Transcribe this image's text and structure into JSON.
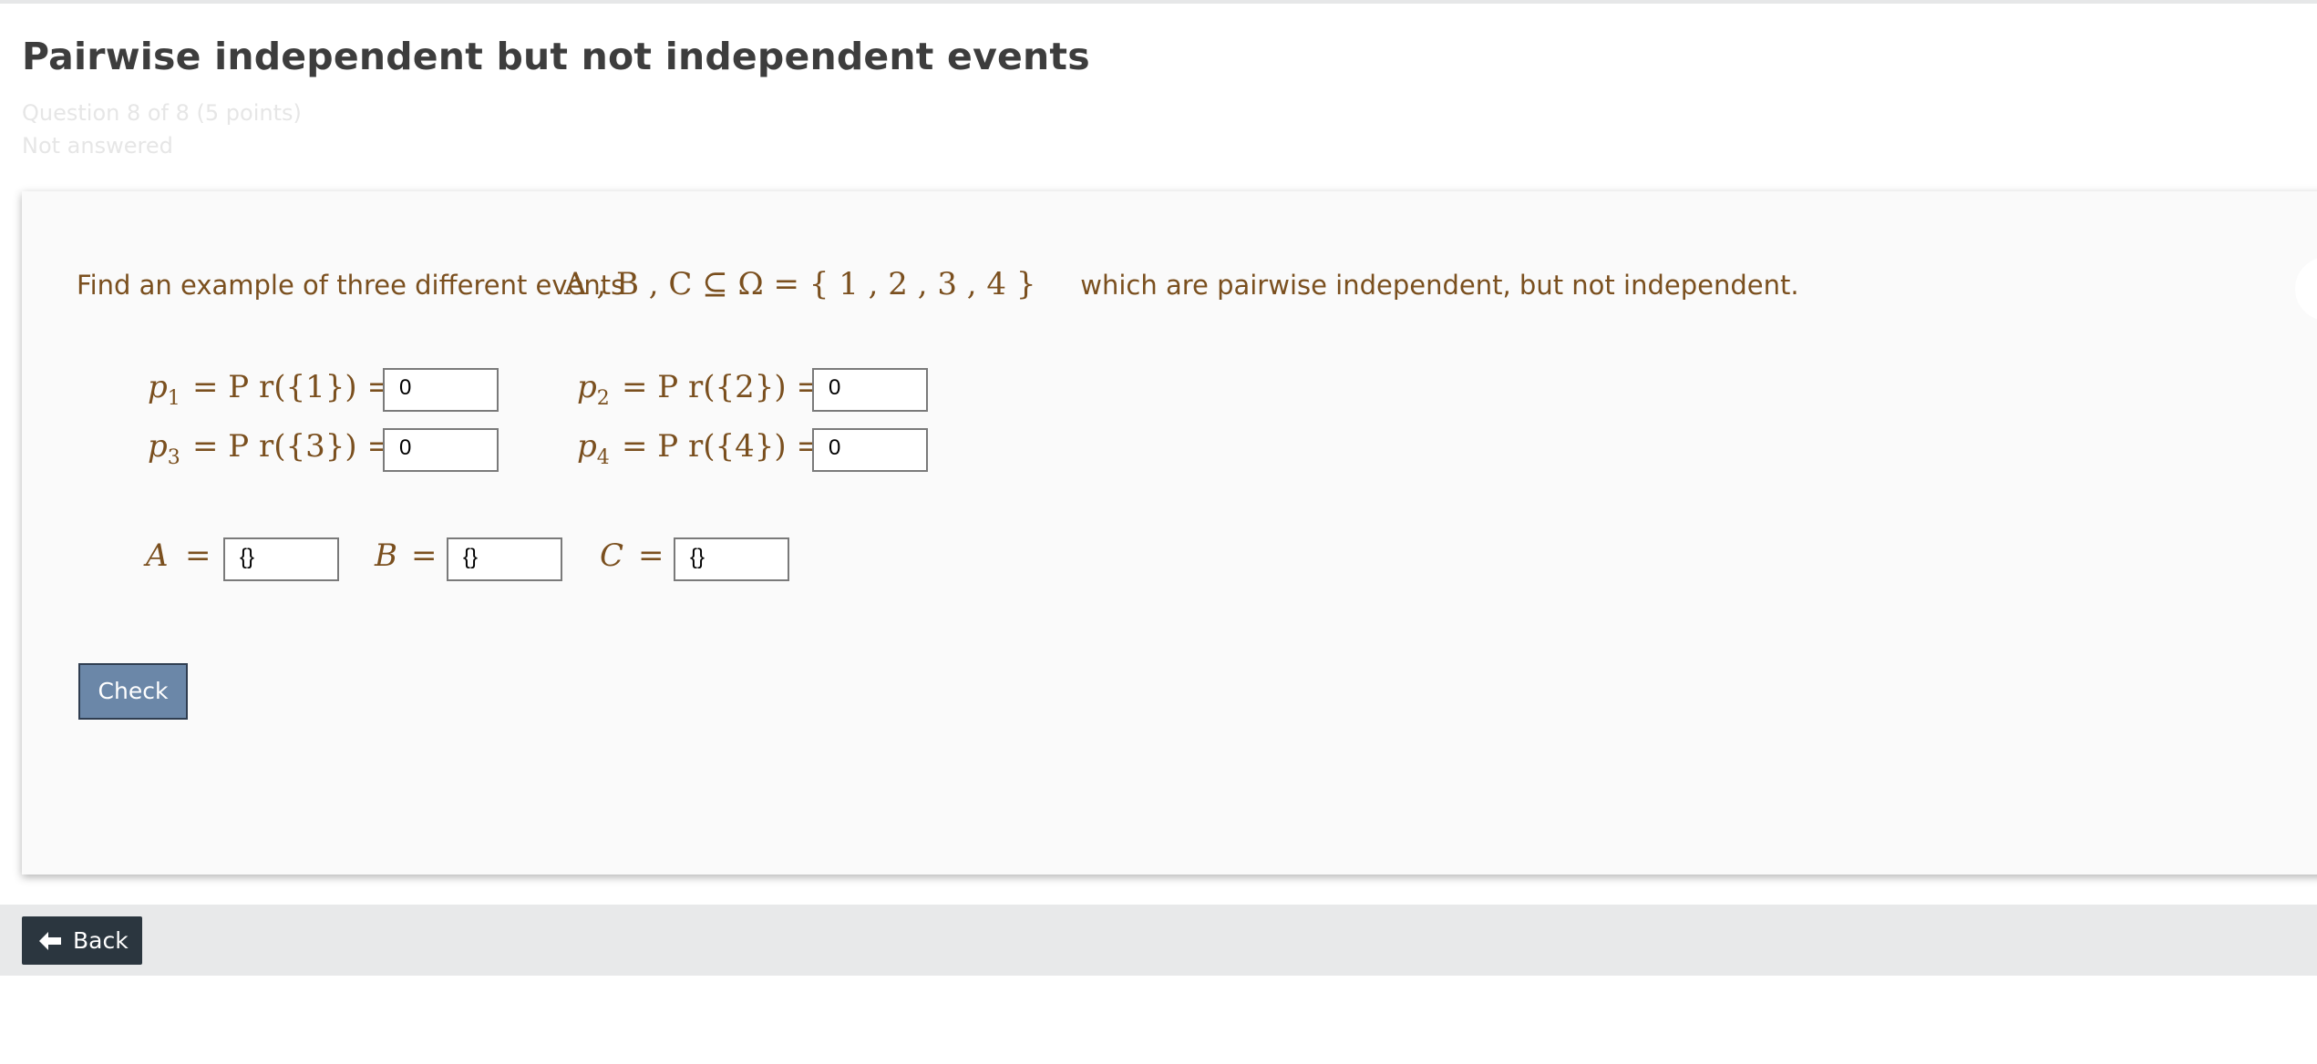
{
  "page": {
    "title": "Pairwise independent but not independent events",
    "question_info": "Question 8 of 8 (5 points)",
    "status": "Not answered"
  },
  "question": {
    "prompt_before": "Find an example of three different events",
    "math_events": "A , B , C ⊆ Ω = { 1 , 2 , 3 , 4 }",
    "prompt_after": "which are pairwise independent, but not independent.",
    "probabilities": [
      {
        "var": "p",
        "sub": "1",
        "expr": "= P r({1}) =",
        "value": "0"
      },
      {
        "var": "p",
        "sub": "2",
        "expr": "= P r({2}) =",
        "value": "0"
      },
      {
        "var": "p",
        "sub": "3",
        "expr": "= P r({3}) =",
        "value": "0"
      },
      {
        "var": "p",
        "sub": "4",
        "expr": "= P r({4}) =",
        "value": "0"
      }
    ],
    "sets": [
      {
        "var": "A",
        "eq": "=",
        "value": "{}"
      },
      {
        "var": "B",
        "eq": "=",
        "value": "{}"
      },
      {
        "var": "C",
        "eq": "=",
        "value": "{}"
      }
    ]
  },
  "actions": {
    "check_label": "Check",
    "back_label": "Back"
  },
  "icons": {
    "back": "arrow-left-icon"
  }
}
